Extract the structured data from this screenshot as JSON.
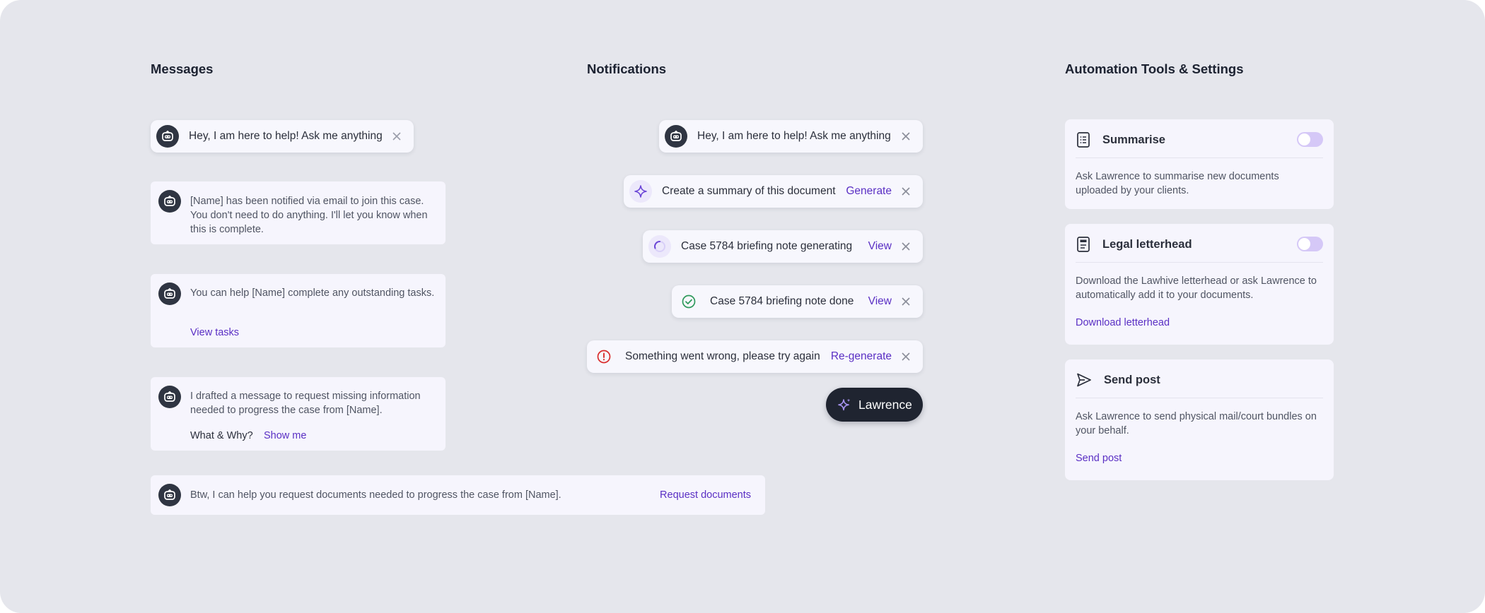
{
  "sections": {
    "messages": "Messages",
    "notifications": "Notifications",
    "automation": "Automation Tools & Settings"
  },
  "messages": {
    "greeting": "Hey, I am here to help! Ask me anything",
    "notified": "[Name] has been notified via email to join this case. You don't need to do anything. I'll let you know when this is complete.",
    "tasks_text": "You can help [Name] complete any outstanding tasks.",
    "tasks_link": "View tasks",
    "drafted_text": "I drafted a message to request missing information needed to progress the case from [Name].",
    "what_why": "What & Why?",
    "show_me": "Show me",
    "btw_text": "Btw, I can help you request documents needed to progress the case from [Name].",
    "btw_link": "Request documents"
  },
  "notifications": {
    "greeting": "Hey, I am here to help! Ask me anything",
    "summary_text": "Create a summary of this document",
    "summary_action": "Generate",
    "generating_text": "Case 5784 briefing note generating",
    "generating_action": "View",
    "done_text": "Case 5784 briefing note done",
    "done_action": "View",
    "error_text": "Something went wrong, please try again",
    "error_action": "Re-generate",
    "fab_label": "Lawrence"
  },
  "settings": {
    "summarise": {
      "title": "Summarise",
      "desc": "Ask Lawrence to summarise new documents uploaded by your clients.",
      "enabled": false
    },
    "letterhead": {
      "title": "Legal letterhead",
      "desc": "Download the Lawhive letterhead or ask Lawrence to automatically add it to your documents.",
      "link": "Download letterhead",
      "enabled": false
    },
    "post": {
      "title": "Send post",
      "desc": "Ask Lawrence to send physical mail/court bundles on your behalf.",
      "link": "Send post"
    }
  },
  "colors": {
    "background": "#e5e6ec",
    "card": "#f6f5fd",
    "link": "#5a2fc4",
    "avatar": "#2f3542",
    "success": "#2f9a5c",
    "error": "#d92d2d",
    "toggle_off": "#d5c8f7"
  },
  "icons": {
    "avatar": "robot-avatar-icon",
    "close": "close-icon",
    "sparkle": "sparkle-icon",
    "spinner": "loading-spinner-icon",
    "success": "check-circle-icon",
    "error": "alert-circle-icon",
    "summarise": "list-document-icon",
    "letterhead": "letterhead-document-icon",
    "post": "send-icon"
  }
}
